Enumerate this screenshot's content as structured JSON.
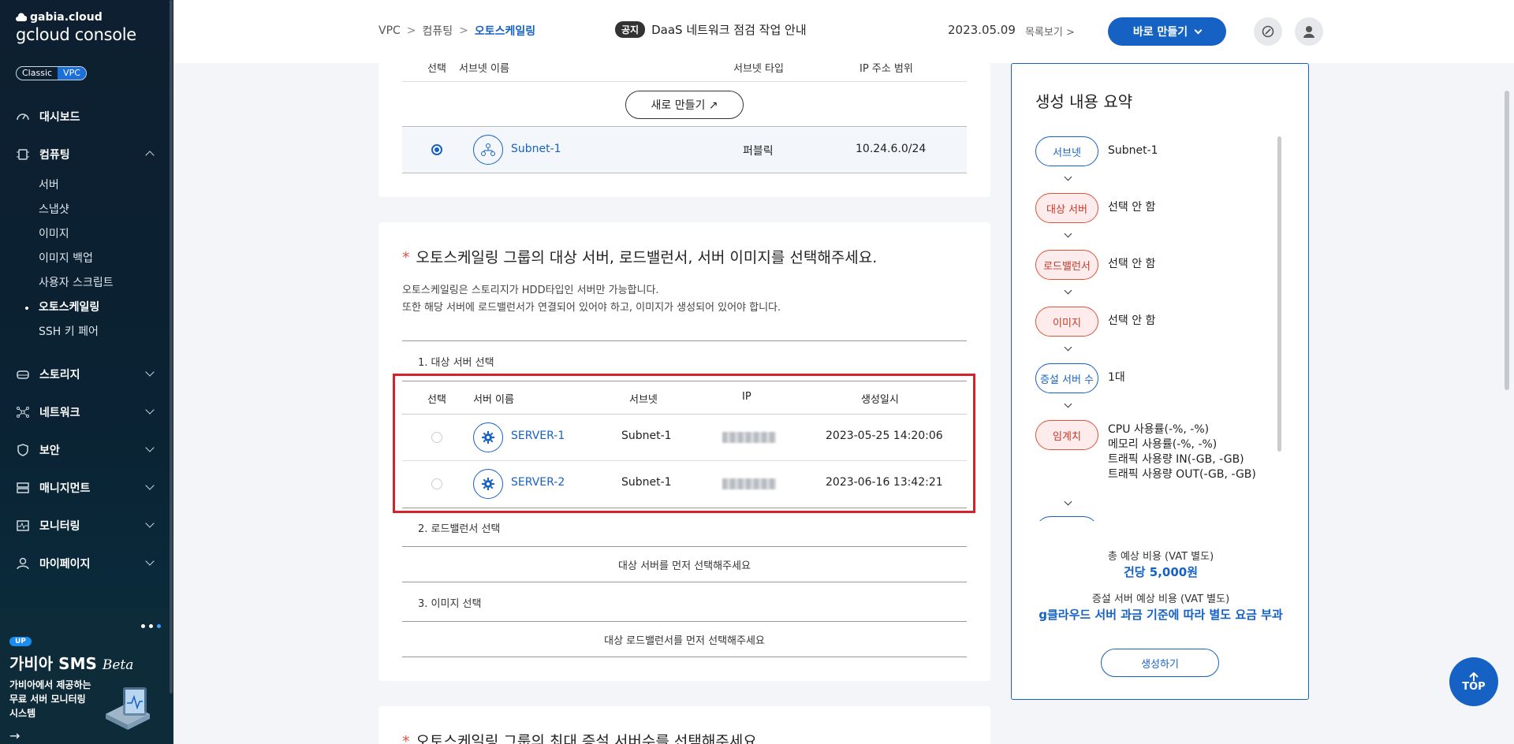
{
  "brand": {
    "top": "gabia.cloud",
    "main": "gcloud console"
  },
  "mode": {
    "classic": "Classic",
    "vpc": "VPC"
  },
  "nav": {
    "dashboard": "대시보드",
    "computing": "컴퓨팅",
    "sub": [
      "서버",
      "스냅샷",
      "이미지",
      "이미지 백업",
      "사용자 스크립트",
      "오토스케일링",
      "SSH 키 페어"
    ],
    "storage": "스토리지",
    "network": "네트워크",
    "security": "보안",
    "management": "매니지먼트",
    "monitoring": "모니터링",
    "mypage": "마이페이지"
  },
  "promo": {
    "badge": "UP",
    "title": "가비아 SMS",
    "beta": "Beta",
    "desc": "가비아에서 제공하는 무료 서버 모니터링 시스템",
    "arrow": "→"
  },
  "breadcrumb": {
    "a": "VPC",
    "b": "컴퓨팅",
    "c": "오토스케일링",
    "sep": ">"
  },
  "notice": {
    "tag": "공지",
    "text": "DaaS 네트워크 점검 작업 안내",
    "date": "2023.05.09",
    "list": "목록보기 >"
  },
  "header": {
    "create": "바로 만들기"
  },
  "subnet_table": {
    "headers": [
      "선택",
      "서브넷 이름",
      "서브넷 타입",
      "IP 주소 범위"
    ],
    "new_button": "새로 만들기 ↗",
    "row": {
      "name": "Subnet-1",
      "type": "퍼블릭",
      "range": "10.24.6.0/24"
    }
  },
  "section2": {
    "title": "오토스케일링 그룹의 대상 서버, 로드밸런서, 서버 이미지를 선택해주세요.",
    "desc1": "오토스케일링은 스토리지가 HDD타입인 서버만 가능합니다.",
    "desc2": "또한 해당 서버에 로드밸런서가 연결되어 있어야 하고, 이미지가 생성되어 있어야 합니다.",
    "step1": "1. 대상 서버 선택",
    "server_headers": [
      "선택",
      "서버 이름",
      "서브넷",
      "IP",
      "생성일시"
    ],
    "servers": [
      {
        "name": "SERVER-1",
        "subnet": "Subnet-1",
        "created": "2023-05-25 14:20:06"
      },
      {
        "name": "SERVER-2",
        "subnet": "Subnet-1",
        "created": "2023-06-16 13:42:21"
      }
    ],
    "step2": "2. 로드밸런서 선택",
    "lb_placeholder": "대상 서버를 먼저 선택해주세요",
    "step3": "3. 이미지 선택",
    "img_placeholder": "대상 로드밸런서를 먼저 선택해주세요"
  },
  "section3": {
    "title": "오토스케일링 그룹의 최대 증설 서버수를 선택해주세요."
  },
  "summary": {
    "title": "생성 내용 요약",
    "items": [
      {
        "tag": "서브넷",
        "value": "Subnet-1"
      },
      {
        "tag": "대상 서버",
        "value": "선택 안 함"
      },
      {
        "tag": "로드밸런서",
        "value": "선택 안 함"
      },
      {
        "tag": "이미지",
        "value": "선택 안 함"
      },
      {
        "tag": "증설 서버 수",
        "value": "1대"
      },
      {
        "tag": "임계치",
        "lines": [
          "CPU 사용률(-%, -%)",
          "메모리 사용률(-%, -%)",
          "트래픽 사용량 IN(-GB, -GB)",
          "트래픽 사용량 OUT(-GB, -GB)"
        ]
      }
    ],
    "total_label": "총 예상 비용 (VAT 별도)",
    "total_value": "건당 5,000원",
    "extra_label": "증설 서버 예상 비용 (VAT 별도)",
    "extra_value": "g클라우드 서버 과금 기준에 따라 별도 요금 부과",
    "button": "생성하기"
  },
  "top_button": "TOP"
}
